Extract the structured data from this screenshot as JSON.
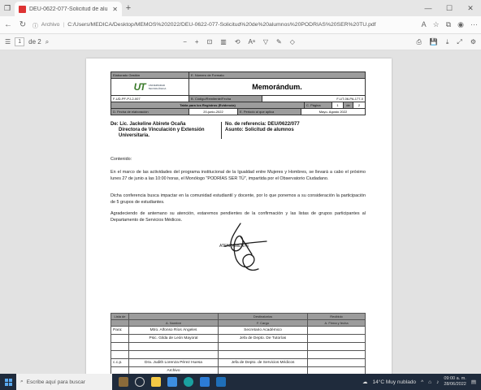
{
  "browser": {
    "tab_title": "DEU-0622-077-Solicitud de alu",
    "new_tab": "+",
    "url_info": "ⓘ",
    "url_label": "Archivo",
    "url": "C:/Users/MEDICA/Desktop/MEMOS%202022/DEU-0622-077-Solicitud%20de%20alumnos%20PODRIAS%20SER%20TU.pdf"
  },
  "pdf_toolbar": {
    "page_current": "1",
    "page_total": "de 2"
  },
  "document": {
    "header": {
      "elaborado": "Elaborado Gestión",
      "num_formato": "E. Número de Formato",
      "title": "Memorándum.",
      "code_left": "F-UD-PF-PJ-2-007",
      "code_mid": "B. Código/Remitente/Fecha",
      "code_right": "F-UT-06-PA-177-0",
      "tabla": "Tabla para los Registros (Evidencia)",
      "pagina_label": "C. Página",
      "pagina_val": "1",
      "de_label": "de",
      "de_val": "2",
      "fecha_label": "D. Fecha de elaboración",
      "fecha_val": "20-junio-2022",
      "periodo_label": "E. Periodo al que aplica",
      "periodo_val": "Mayo- Agosto 2022"
    },
    "de": "De: Lic. Jackeline Abirete Ocaña",
    "de_line2": "Directora de Vinculación y Extensión",
    "de_line3": "Universitaria.",
    "ref": "No. de referencia: DEU/0622/077",
    "asunto": "Asunto: Solicitud de alumnos",
    "contenido": "Contenido:",
    "p1": "En el marco de las actividades del programa institucional de la Igualdad entre Mujeres y Hombres, se llevará a cabo el próximo lunes 27 de junio a las 10:00 horas, el Monólogo \"PODRÍAS SER TÚ\", impartida por el Observatorio Ciudadano.",
    "p2": "Dicha conferencia busca impactar en la comunidad estudiantil y docente, por lo que ponemos a su consideración la participación de 5 grupos de estudiantes.",
    "p3": "Agradeciendo de antemano su atención, estaremos pendientes de la confirmación y las listas de grupos participantes al Departamento de Servicios Médicos.",
    "atentamente": "ATENTAMENTE",
    "dist": {
      "h_lista": "Lista de",
      "h_dest": "Destinatarios",
      "h_nombre": "A. Nombre",
      "h_cargo": "F. Cargo",
      "h_recibido": "Recibido",
      "h_firma": "A. Firma y fecha",
      "rows": [
        {
          "tipo": "Para:",
          "nombre": "Mtro. Alfonso Ríos Ángeles",
          "cargo": "Secretario Académico"
        },
        {
          "tipo": "",
          "nombre": "Psic. Gilda de León Mayoral",
          "cargo": "Jefa de Depto. De Tutorías"
        },
        {
          "tipo": "",
          "nombre": "",
          "cargo": ""
        },
        {
          "tipo": "",
          "nombre": "",
          "cargo": ""
        },
        {
          "tipo": "c.c.p.",
          "nombre": "Dra. Judith Lorenza Pérez Huesa",
          "cargo": "Jefa de Depto. de Servicios Médicos"
        },
        {
          "tipo": "",
          "nombre": "Archivo",
          "cargo": ""
        },
        {
          "tipo": "",
          "nombre": "",
          "cargo": ""
        }
      ]
    }
  },
  "taskbar": {
    "search_placeholder": "Escribe aquí para buscar",
    "weather": "14°C Muy nublado",
    "time": "09:00 a. m.",
    "date": "28/06/2022"
  }
}
